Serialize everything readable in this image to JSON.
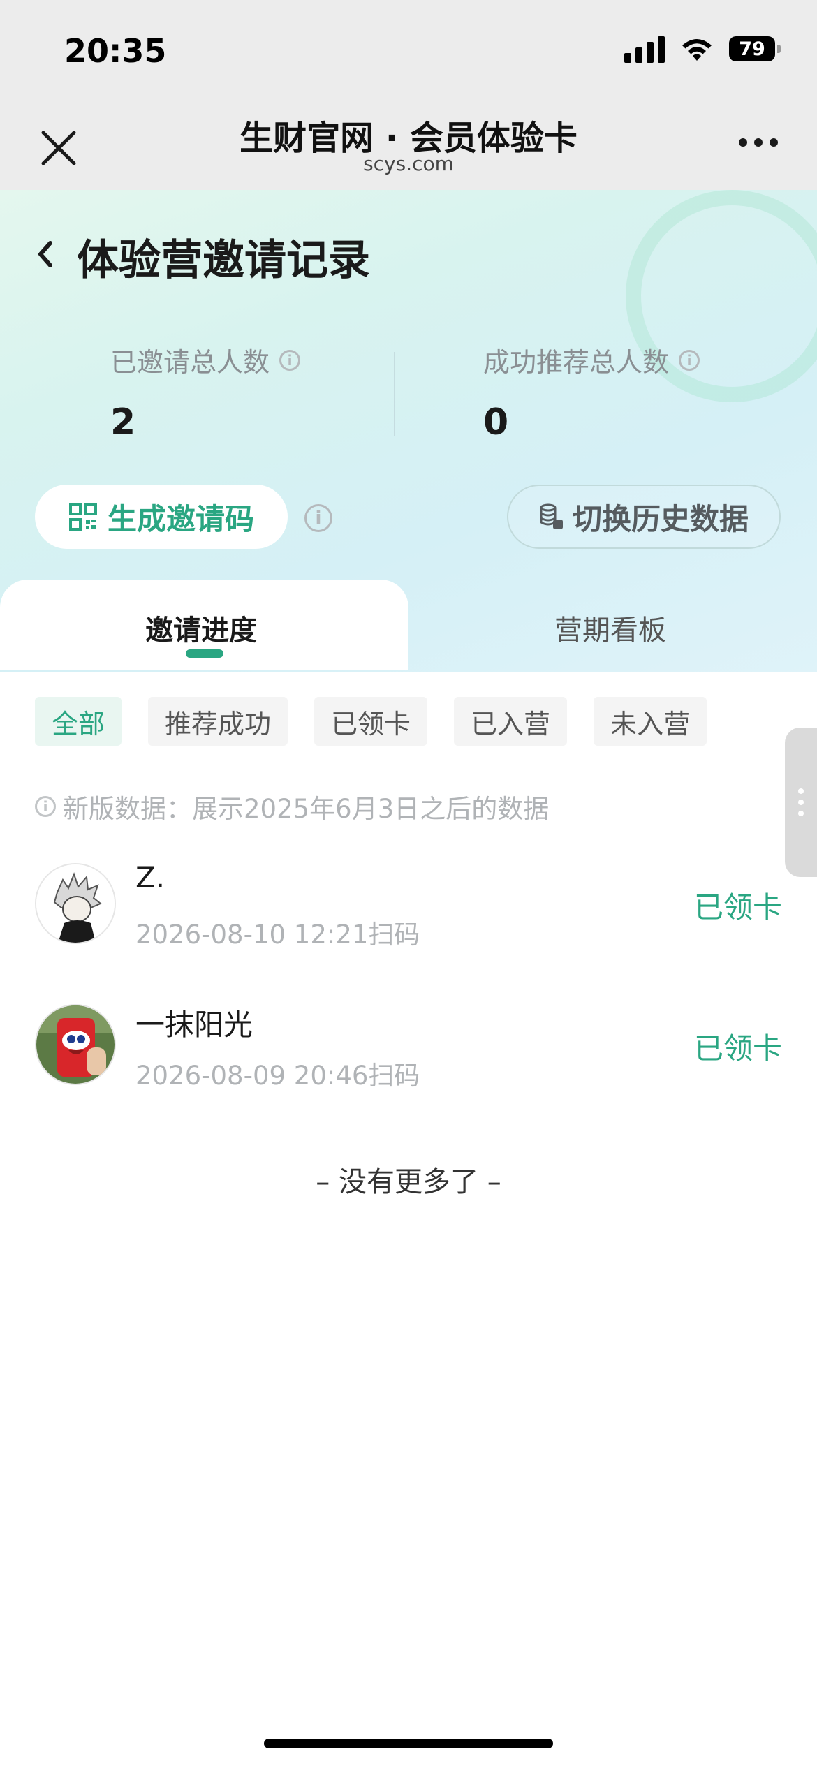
{
  "status_bar": {
    "time": "20:35",
    "battery": "79"
  },
  "browser": {
    "title": "生财官网 · 会员体验卡",
    "url": "scys.com"
  },
  "page": {
    "title": "体验营邀请记录"
  },
  "stats": [
    {
      "label": "已邀请总人数",
      "value": "2"
    },
    {
      "label": "成功推荐总人数",
      "value": "0"
    }
  ],
  "actions": {
    "invite_label": "生成邀请码",
    "history_label": "切换历史数据"
  },
  "tabs": [
    {
      "label": "邀请进度",
      "active": true
    },
    {
      "label": "营期看板",
      "active": false
    }
  ],
  "filters": [
    "全部",
    "推荐成功",
    "已领卡",
    "已入营",
    "未入营"
  ],
  "notice": "新版数据：展示2025年6月3日之后的数据",
  "invitees": [
    {
      "name": "Z.",
      "time": "2026-08-10 12:21扫码",
      "status": "已领卡"
    },
    {
      "name": "一抹阳光",
      "time": "2026-08-09 20:46扫码",
      "status": "已领卡"
    }
  ],
  "footer": {
    "no_more": "– 没有更多了 –"
  },
  "colors": {
    "accent": "#2aa682",
    "header_bg": "#ececec"
  }
}
